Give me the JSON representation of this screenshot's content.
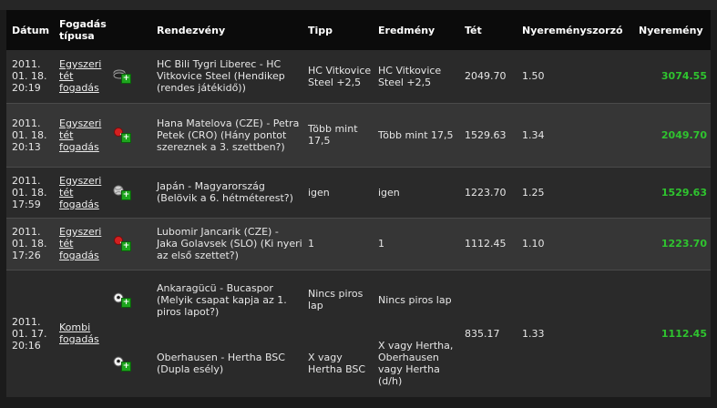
{
  "headers": {
    "date": "Dátum",
    "bet_type": "Fogadás típusa",
    "event": "Rendezvény",
    "tip": "Tipp",
    "result": "Eredmény",
    "stake": "Tét",
    "odds": "Nyereményszorzó",
    "winnings": "Nyeremény"
  },
  "rows": [
    {
      "date": "2011. 01. 18. 20:19",
      "bet_type": "Egyszeri tét fogadás",
      "event": "HC Bili Tygri Liberec - HC Vitkovice Steel (Hendikep (rendes játékidő))",
      "tip": "HC Vitkovice Steel +2,5",
      "result": "HC Vitkovice Steel +2,5",
      "stake": "2049.70",
      "odds": "1.50",
      "winnings": "3074.55",
      "sport_icon": "hockey-puck-icon"
    },
    {
      "date": "2011. 01. 18. 20:13",
      "bet_type": "Egyszeri tét fogadás",
      "event": "Hana Matelova (CZE) - Petra Petek (CRO) (Hány pontot szereznek a 3. szettben?)",
      "tip": "Több mint 17,5",
      "result": "Több mint 17,5",
      "stake": "1529.63",
      "odds": "1.34",
      "winnings": "2049.70",
      "sport_icon": "table-tennis-icon"
    },
    {
      "date": "2011. 01. 18. 17:59",
      "bet_type": "Egyszeri tét fogadás",
      "event": "Japán - Magyarország (Belövik a 6. hétméterest?)",
      "tip": "igen",
      "result": "igen",
      "stake": "1223.70",
      "odds": "1.25",
      "winnings": "1529.63",
      "sport_icon": "handball-icon"
    },
    {
      "date": "2011. 01. 18. 17:26",
      "bet_type": "Egyszeri tét fogadás",
      "event": "Lubomir Jancarik (CZE) - Jaka Golavsek (SLO) (Ki nyeri az első szettet?)",
      "tip": "1",
      "result": "1",
      "stake": "1112.45",
      "odds": "1.10",
      "winnings": "1223.70",
      "sport_icon": "table-tennis-icon"
    },
    {
      "date": "2011. 01. 17. 20:16",
      "bet_type": "Kombi fogadás",
      "stake": "835.17",
      "odds": "1.33",
      "winnings": "1112.45",
      "legs": [
        {
          "event": "Ankaragücü - Bucaspor (Melyik csapat kapja az 1. piros lapot?)",
          "tip": "Nincs piros lap",
          "result": "Nincs piros lap",
          "sport_icon": "soccer-ball-icon"
        },
        {
          "event": "Oberhausen - Hertha BSC (Dupla esély)",
          "tip": "X vagy Hertha BSC",
          "result": "X vagy Hertha, Oberhausen vagy Hertha (d/h)",
          "sport_icon": "soccer-ball-icon"
        }
      ]
    }
  ]
}
